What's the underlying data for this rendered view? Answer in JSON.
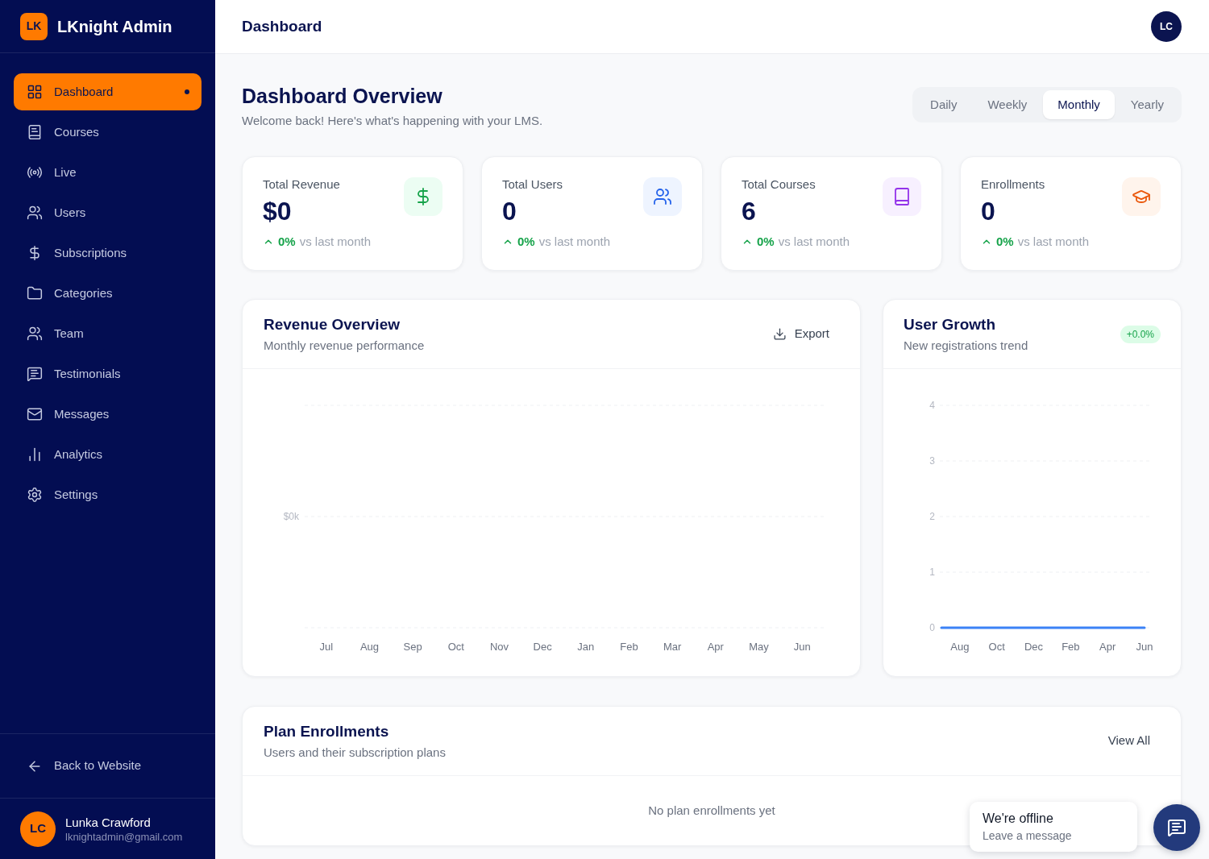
{
  "sidebar": {
    "logo": {
      "initials": "LK",
      "title": "LKnight Admin"
    },
    "nav_items": [
      {
        "label": "Dashboard",
        "selected": true
      },
      {
        "label": "Courses",
        "selected": false
      },
      {
        "label": "Live",
        "selected": false
      },
      {
        "label": "Users",
        "selected": false
      },
      {
        "label": "Subscriptions",
        "selected": false
      },
      {
        "label": "Categories",
        "selected": false
      },
      {
        "label": "Team",
        "selected": false
      },
      {
        "label": "Testimonials",
        "selected": false
      },
      {
        "label": "Messages",
        "selected": false
      },
      {
        "label": "Analytics",
        "selected": false
      },
      {
        "label": "Settings",
        "selected": false
      }
    ],
    "back_link": "Back to Website",
    "user": {
      "initials": "LC",
      "name": "Lunka Crawford",
      "email": "lknightadmin@gmail.com"
    }
  },
  "header": {
    "title": "Dashboard",
    "avatar_initials": "LC"
  },
  "page": {
    "title": "Dashboard Overview",
    "subtitle": "Welcome back! Here's what's happening with your LMS."
  },
  "period_tabs": [
    {
      "label": "Daily",
      "selected": false
    },
    {
      "label": "Weekly",
      "selected": false
    },
    {
      "label": "Monthly",
      "selected": true
    },
    {
      "label": "Yearly",
      "selected": false
    }
  ],
  "stats": [
    {
      "label": "Total Revenue",
      "value": "$0",
      "change": "0%",
      "note": "vs last month"
    },
    {
      "label": "Total Users",
      "value": "0",
      "change": "0%",
      "note": "vs last month"
    },
    {
      "label": "Total Courses",
      "value": "6",
      "change": "0%",
      "note": "vs last month"
    },
    {
      "label": "Enrollments",
      "value": "0",
      "change": "0%",
      "note": "vs last month"
    }
  ],
  "revenue_chart": {
    "title": "Revenue Overview",
    "subtitle": "Monthly revenue performance",
    "export_label": "Export",
    "axis_labels": {
      "x": [
        "Jul",
        "Aug",
        "Sep",
        "Oct",
        "Nov",
        "Dec",
        "Jan",
        "Feb",
        "Mar",
        "Apr",
        "May",
        "Jun"
      ],
      "y": [
        "$0k"
      ]
    }
  },
  "user_growth": {
    "title": "User Growth",
    "subtitle": "New registrations trend",
    "badge": "+0.0%",
    "chart_data": {
      "type": "line",
      "categories": [
        null,
        "Aug",
        null,
        "Oct",
        null,
        "Dec",
        null,
        "Feb",
        null,
        "Apr",
        null,
        "Jun"
      ],
      "ylim": [
        0,
        4
      ],
      "yticks": [
        0,
        1,
        2,
        3,
        4
      ],
      "grid": true,
      "series": [
        {
          "color": "#3b82f6",
          "values": [
            0,
            0,
            0,
            0,
            0,
            0,
            0,
            0,
            0,
            0,
            0,
            0
          ]
        }
      ]
    }
  },
  "plan_enrollments": {
    "title": "Plan Enrollments",
    "subtitle": "Users and their subscription plans",
    "view_all": "View All",
    "empty_message": "No plan enrollments yet"
  },
  "chat_widget": {
    "status": "We're offline",
    "prompt": "Leave a message"
  }
}
